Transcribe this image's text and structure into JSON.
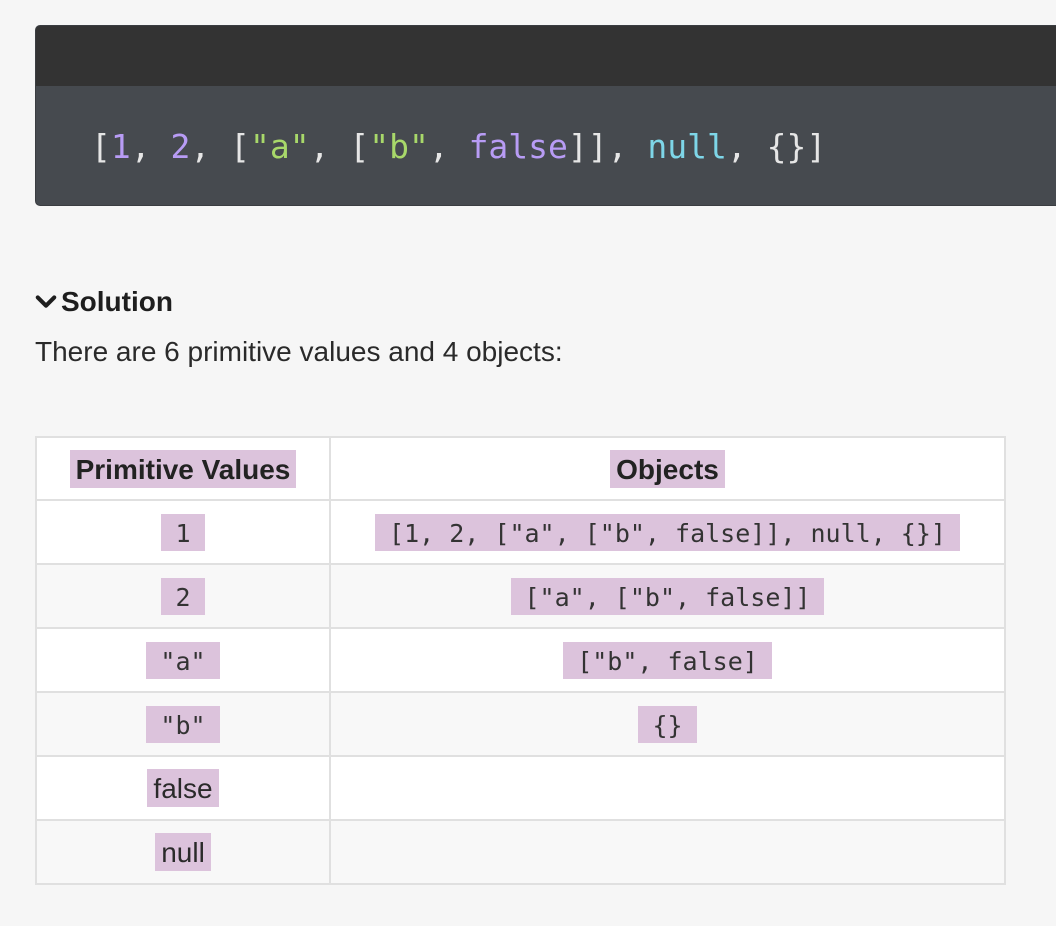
{
  "code": {
    "tokens": [
      {
        "t": "[",
        "c": "pun"
      },
      {
        "t": "1",
        "c": "num"
      },
      {
        "t": ", ",
        "c": "pun"
      },
      {
        "t": "2",
        "c": "num"
      },
      {
        "t": ", [",
        "c": "pun"
      },
      {
        "t": "\"a\"",
        "c": "str"
      },
      {
        "t": ", [",
        "c": "pun"
      },
      {
        "t": "\"b\"",
        "c": "str"
      },
      {
        "t": ", ",
        "c": "pun"
      },
      {
        "t": "false",
        "c": "kw"
      },
      {
        "t": "]], ",
        "c": "pun"
      },
      {
        "t": "null",
        "c": "null"
      },
      {
        "t": ", {}]",
        "c": "pun"
      }
    ],
    "colors": {
      "number": "#b89cf5",
      "string": "#a8d86a",
      "keyword": "#b89cf5",
      "null": "#7ed6e8",
      "punctuation": "#e6e6e6"
    }
  },
  "solution": {
    "heading": "Solution",
    "icon": "chevron-down-icon",
    "summary": "There are 6 primitive values and 4 objects:"
  },
  "table": {
    "headers": {
      "primitive": "Primitive Values",
      "objects": "Objects"
    },
    "rows": [
      {
        "primitive": "1",
        "primitive_kind": "code",
        "object": "[1, 2, [\"a\", [\"b\", false]], null, {}]"
      },
      {
        "primitive": "2",
        "primitive_kind": "code",
        "object": "[\"a\", [\"b\", false]]"
      },
      {
        "primitive": "\"a\"",
        "primitive_kind": "code",
        "object": "[\"b\", false]"
      },
      {
        "primitive": "\"b\"",
        "primitive_kind": "code",
        "object": "{}"
      },
      {
        "primitive": "false",
        "primitive_kind": "text",
        "object": ""
      },
      {
        "primitive": "null",
        "primitive_kind": "text",
        "object": ""
      }
    ],
    "highlight_color": "#dcc3dc"
  }
}
